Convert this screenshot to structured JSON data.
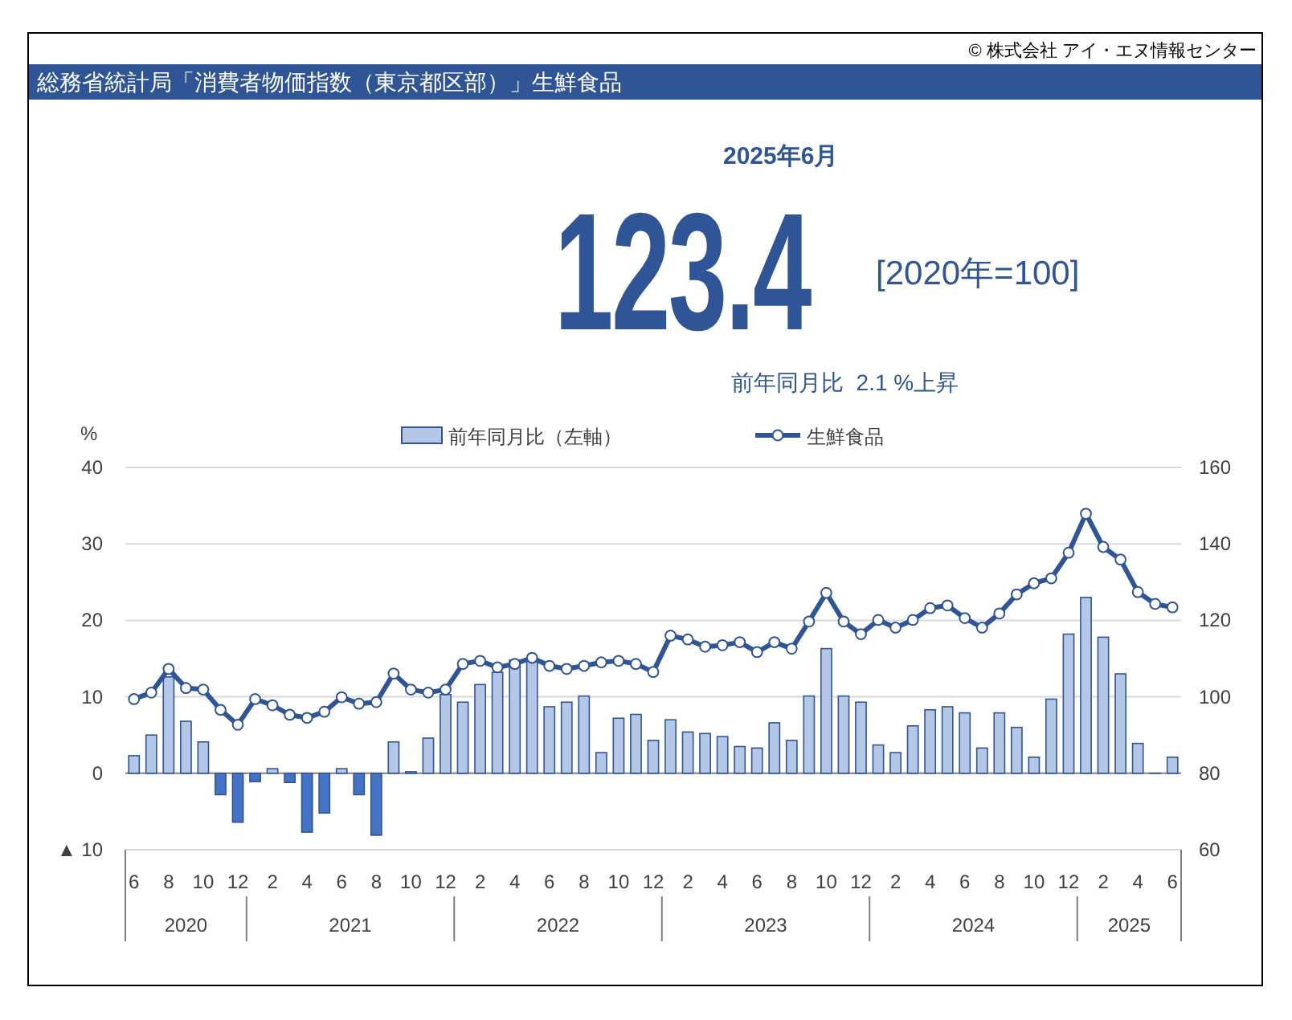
{
  "copyright": "© 株式会社 アイ・エヌ情報センター",
  "header": {
    "title": "総務省統計局「消費者物価指数（東京都区部）」生鮮食品"
  },
  "summary": {
    "period": "2025年6月",
    "value": "123.4",
    "base": "[2020年=100]",
    "change": "前年同月比  2.1 %上昇"
  },
  "chart": {
    "unit_label": "%",
    "year_labels": [
      "2020",
      "2021",
      "2022",
      "2023",
      "2024",
      "2025"
    ],
    "bar_chart": {
      "chart_data": {
        "type": "bar",
        "stacked": true,
        "grid": true,
        "categories": [
          "6",
          null,
          "8",
          null,
          "10",
          null,
          "12",
          null,
          "2",
          null,
          "4",
          null,
          "6",
          null,
          "8",
          null,
          "10",
          null,
          "12",
          null,
          "2",
          null,
          "4",
          null,
          "6",
          null,
          "8",
          null,
          "10",
          null,
          "12",
          null,
          "2",
          null,
          "4",
          null,
          "6",
          null,
          "8",
          null,
          "10",
          null,
          "12",
          null,
          "2",
          null,
          "4",
          null,
          "6",
          null,
          "8",
          null,
          "10",
          null,
          "12",
          null,
          "2",
          null,
          "4",
          null,
          "6"
        ],
        "series": [
          {
            "name": "前年同月比（左軸）",
            "color": "#b4c7e7",
            "values": [
              2.3,
              5.0,
              12.6,
              6.8,
              4.1,
              null,
              null,
              null,
              0.6,
              null,
              null,
              null,
              0.6,
              null,
              null,
              4.1,
              0.2,
              4.6,
              10.3,
              9.3,
              11.6,
              13.2,
              14.8,
              14.8,
              8.7,
              9.3,
              10.1,
              2.7,
              7.2,
              7.7,
              4.3,
              7.0,
              5.4,
              5.2,
              4.8,
              3.5,
              3.3,
              6.6,
              4.3,
              10.1,
              16.3,
              10.1,
              9.3,
              3.7,
              2.7,
              6.2,
              8.3,
              8.7,
              7.9,
              3.3,
              7.9,
              6.0,
              2.1,
              9.7,
              18.2,
              23.0,
              17.8,
              13.0,
              3.9,
              0.0,
              2.1
            ]
          },
          {
            "color": "#4472c4",
            "values": [
              null,
              null,
              null,
              null,
              null,
              -2.8,
              -6.4,
              -1.1,
              null,
              -1.2,
              -7.7,
              -5.2,
              null,
              -2.8,
              -8.1,
              null,
              null,
              null,
              null,
              null,
              null,
              null,
              null,
              null,
              null,
              null,
              null,
              null,
              null,
              null,
              null,
              null,
              null,
              null,
              null,
              null,
              null,
              null,
              null,
              null,
              null,
              null,
              null,
              null,
              null,
              null,
              null,
              null,
              null,
              null,
              null,
              null,
              null,
              null,
              null,
              null,
              null,
              null,
              null,
              null,
              null
            ]
          }
        ],
        "ylim": [
          -10,
          40
        ],
        "yticks": [
          40,
          30,
          20,
          10,
          0,
          {
            "value": -10,
            "label": "▲ 10"
          }
        ]
      }
    },
    "line_chart": {
      "chart_data": {
        "type": "line",
        "series": [
          {
            "name": "生鮮食品",
            "color": "#2f5597",
            "marker": "o",
            "values": [
              99.4,
              101.1,
              107.3,
              102.3,
              101.9,
              96.6,
              92.7,
              99.4,
              97.8,
              95.3,
              94.5,
              96.1,
              99.9,
              98.2,
              98.6,
              106.1,
              101.9,
              101.1,
              101.9,
              108.6,
              109.4,
              107.7,
              108.6,
              110.2,
              108.1,
              107.3,
              108.1,
              109.0,
              109.4,
              108.6,
              106.5,
              116.0,
              115.0,
              113.1,
              113.5,
              114.3,
              111.7,
              114.3,
              112.6,
              119.7,
              127.2,
              119.7,
              116.4,
              120.1,
              118.1,
              120.1,
              123.2,
              123.9,
              120.6,
              118.1,
              121.8,
              126.8,
              129.7,
              131.0,
              137.7,
              147.9,
              139.2,
              135.9,
              127.4,
              124.3,
              123.4
            ]
          }
        ],
        "ylim": [
          60,
          160
        ],
        "yticks": [
          160,
          140,
          120,
          100,
          80,
          60
        ]
      }
    }
  }
}
